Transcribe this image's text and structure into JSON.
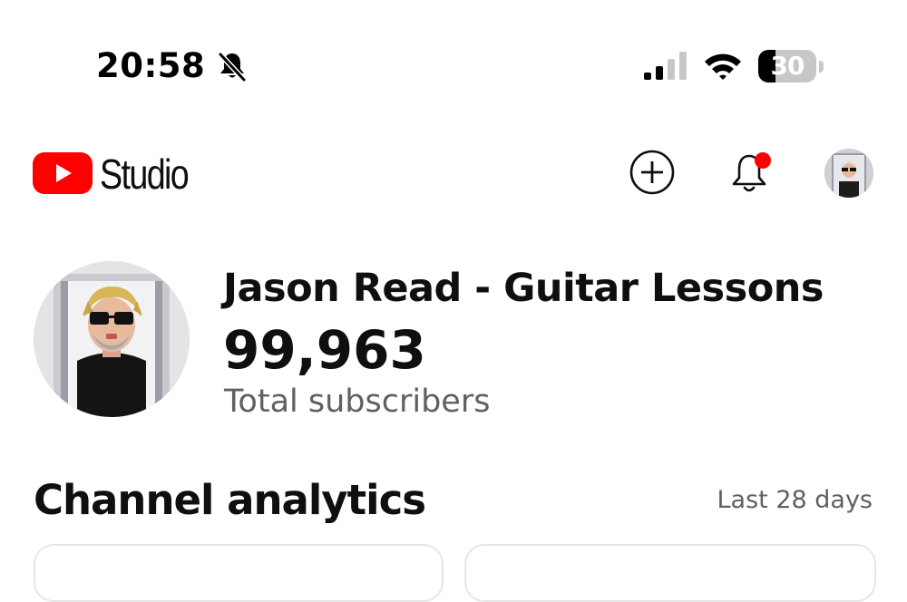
{
  "status_bar": {
    "time": "20:58",
    "battery_level": "30",
    "battery_fraction": 0.3,
    "icons": [
      "bell-slash-icon",
      "cellular-signal-icon",
      "wifi-icon",
      "battery-icon"
    ]
  },
  "header": {
    "app_name": "Studio",
    "logo": "youtube-logo",
    "actions": [
      "create-icon",
      "notifications-bell-icon",
      "account-avatar"
    ],
    "notification_dot_color": "#ff0000"
  },
  "channel": {
    "name": "Jason Read - Guitar Lessons",
    "subscriber_count": "99,963",
    "subscriber_label": "Total subscribers"
  },
  "analytics": {
    "title": "Channel analytics",
    "period": "Last 28 days"
  },
  "colors": {
    "brand_red": "#ff0000",
    "text_primary": "#0f0f0f",
    "text_secondary": "#606060"
  }
}
